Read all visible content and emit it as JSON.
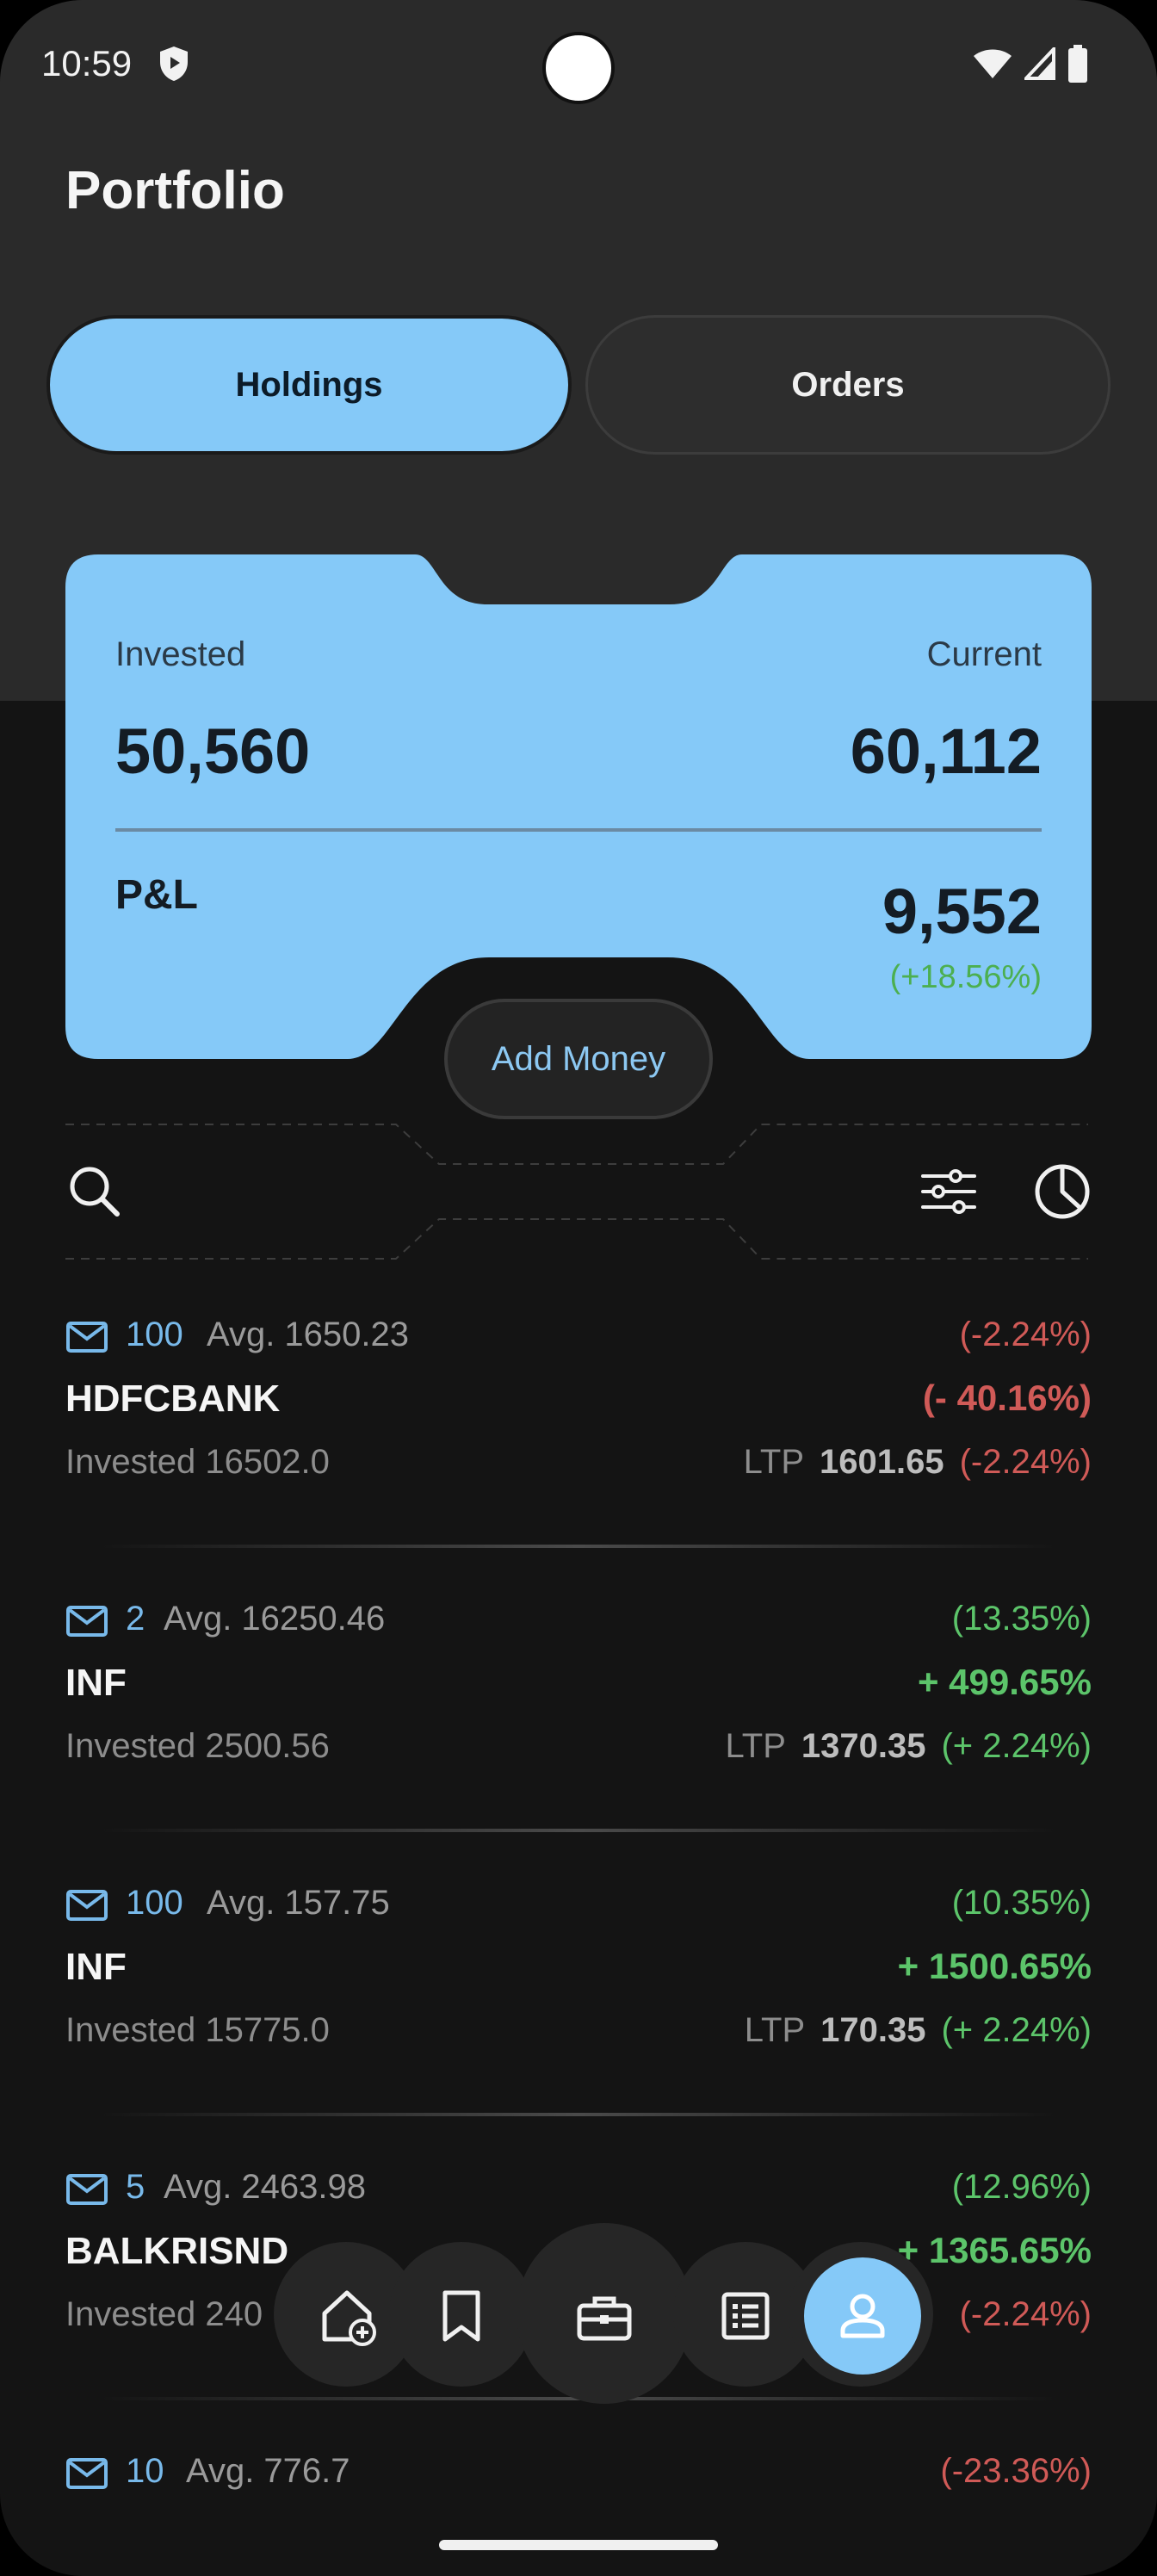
{
  "status_bar": {
    "time": "10:59",
    "icons": [
      "shield-icon",
      "wifi-icon",
      "signal-icon",
      "battery-icon"
    ]
  },
  "page": {
    "title": "Portfolio"
  },
  "tabs": [
    {
      "label": "Holdings",
      "selected": true
    },
    {
      "label": "Orders",
      "selected": false
    }
  ],
  "summary": {
    "invested_label": "Invested",
    "invested_value": "50,560",
    "current_label": "Current",
    "current_value": "60,112",
    "pl_label": "P&L",
    "pl_value": "9,552",
    "pl_percent": "(+18.56%)",
    "add_money_label": "Add Money"
  },
  "toolbar": {
    "icons": [
      "search-icon",
      "filter-sliders-icon",
      "pie-chart-icon"
    ]
  },
  "holdings": [
    {
      "qty": "100",
      "avg": "Avg. 1650.23",
      "pct": "(-2.24%)",
      "name": "HDFCBANK",
      "change": "(- 40.16%)",
      "invested": "Invested 16502.0",
      "ltp_label": "LTP",
      "ltp_value": "1601.65",
      "ltp_change": "(-2.24%)",
      "trend": "down",
      "ltp_trend": "down"
    },
    {
      "qty": "2",
      "avg": "Avg. 16250.46",
      "pct": "(13.35%)",
      "name": "INF",
      "change": "+ 499.65%",
      "invested": "Invested 2500.56",
      "ltp_label": "LTP",
      "ltp_value": "1370.35",
      "ltp_change": "(+ 2.24%)",
      "trend": "up",
      "ltp_trend": "up"
    },
    {
      "qty": "100",
      "avg": "Avg. 157.75",
      "pct": "(10.35%)",
      "name": "INF",
      "change": "+ 1500.65%",
      "invested": "Invested 15775.0",
      "ltp_label": "LTP",
      "ltp_value": "170.35",
      "ltp_change": "(+ 2.24%)",
      "trend": "up",
      "ltp_trend": "up"
    },
    {
      "qty": "5",
      "avg": "Avg. 2463.98",
      "pct": "(12.96%)",
      "name": "BALKRISND",
      "change": "+ 1365.65%",
      "invested": "Invested 240",
      "ltp_label": "",
      "ltp_value": "",
      "ltp_change": "(-2.24%)",
      "trend": "up",
      "ltp_trend": "down"
    },
    {
      "qty": "10",
      "avg": "Avg. 776.7",
      "pct": "(-23.36%)",
      "name": "",
      "change": "",
      "invested": "",
      "ltp_label": "",
      "ltp_value": "",
      "ltp_change": "",
      "trend": "down",
      "ltp_trend": "down"
    }
  ],
  "bottom_nav": {
    "items": [
      "home-add-icon",
      "bookmark-icon",
      "briefcase-icon",
      "list-icon",
      "profile-icon"
    ],
    "active": "profile-icon"
  },
  "colors": {
    "accent": "#85c9f8",
    "positive": "#5cc46a",
    "negative": "#d05a57",
    "background": "#141414"
  }
}
